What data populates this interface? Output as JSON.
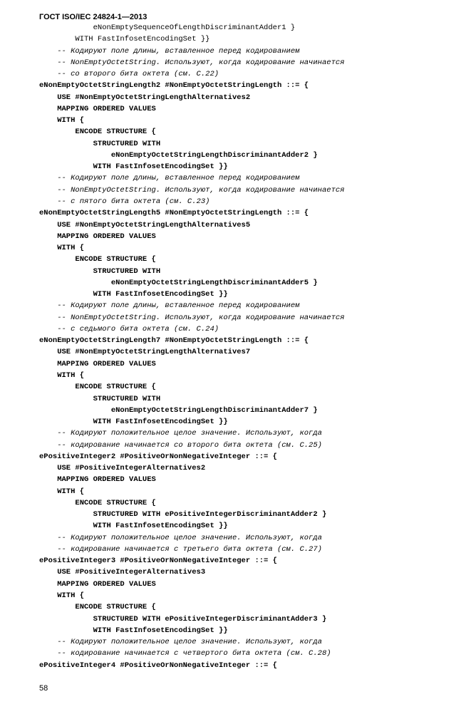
{
  "header": {
    "title": "ГОСТ ISO/IEC 24824-1—2013"
  },
  "page_number": "58",
  "code": [
    {
      "text": "            eNonEmptySequenceOfLengthDiscriminantAdder1 }",
      "bold": false,
      "italic": false
    },
    {
      "text": "        WITH FastInfosetEncodingSet }}",
      "bold": false,
      "italic": false
    },
    {
      "text": "    -- Кодируют поле длины, вставленное перед кодированием",
      "bold": false,
      "italic": true
    },
    {
      "text": "    -- NonEmptyOctetString. Используют, когда кодирование начинается",
      "bold": false,
      "italic": true
    },
    {
      "text": "    -- со второго бита октета (см. С.22)",
      "bold": false,
      "italic": true
    },
    {
      "text": "eNonEmptyOctetStringLength2 #NonEmptyOctetStringLength ::= {",
      "bold": true,
      "italic": false
    },
    {
      "text": "    USE #NonEmptyOctetStringLengthAlternatives2",
      "bold": true,
      "italic": false
    },
    {
      "text": "    MAPPING ORDERED VALUES",
      "bold": true,
      "italic": false
    },
    {
      "text": "    WITH {",
      "bold": true,
      "italic": false
    },
    {
      "text": "        ENCODE STRUCTURE {",
      "bold": true,
      "italic": false
    },
    {
      "text": "            STRUCTURED WITH",
      "bold": true,
      "italic": false
    },
    {
      "text": "                eNonEmptyOctetStringLengthDiscriminantAdder2 }",
      "bold": true,
      "italic": false
    },
    {
      "text": "            WITH FastInfosetEncodingSet }}",
      "bold": true,
      "italic": false
    },
    {
      "text": "    -- Кодируют поле длины, вставленное перед кодированием",
      "bold": false,
      "italic": true
    },
    {
      "text": "    -- NonEmptyOctetString. Используют, когда кодирование начинается",
      "bold": false,
      "italic": true
    },
    {
      "text": "    -- с пятого бита октета (см. С.23)",
      "bold": false,
      "italic": true
    },
    {
      "text": "eNonEmptyOctetStringLength5 #NonEmptyOctetStringLength ::= {",
      "bold": true,
      "italic": false
    },
    {
      "text": "    USE #NonEmptyOctetStringLengthAlternatives5",
      "bold": true,
      "italic": false
    },
    {
      "text": "    MAPPING ORDERED VALUES",
      "bold": true,
      "italic": false
    },
    {
      "text": "    WITH {",
      "bold": true,
      "italic": false
    },
    {
      "text": "        ENCODE STRUCTURE {",
      "bold": true,
      "italic": false
    },
    {
      "text": "            STRUCTURED WITH",
      "bold": true,
      "italic": false
    },
    {
      "text": "                eNonEmptyOctetStringLengthDiscriminantAdder5 }",
      "bold": true,
      "italic": false
    },
    {
      "text": "            WITH FastInfosetEncodingSet }}",
      "bold": true,
      "italic": false
    },
    {
      "text": "    -- Кодируют поле длины, вставленное перед кодированием",
      "bold": false,
      "italic": true
    },
    {
      "text": "    -- NonEmptyOctetString. Используют, когда кодирование начинается",
      "bold": false,
      "italic": true
    },
    {
      "text": "    -- с седьмого бита октета (см. С.24)",
      "bold": false,
      "italic": true
    },
    {
      "text": "eNonEmptyOctetStringLength7 #NonEmptyOctetStringLength ::= {",
      "bold": true,
      "italic": false
    },
    {
      "text": "    USE #NonEmptyOctetStringLengthAlternatives7",
      "bold": true,
      "italic": false
    },
    {
      "text": "    MAPPING ORDERED VALUES",
      "bold": true,
      "italic": false
    },
    {
      "text": "    WITH {",
      "bold": true,
      "italic": false
    },
    {
      "text": "        ENCODE STRUCTURE {",
      "bold": true,
      "italic": false
    },
    {
      "text": "            STRUCTURED WITH",
      "bold": true,
      "italic": false
    },
    {
      "text": "                eNonEmptyOctetStringLengthDiscriminantAdder7 }",
      "bold": true,
      "italic": false
    },
    {
      "text": "            WITH FastInfosetEncodingSet }}",
      "bold": true,
      "italic": false
    },
    {
      "text": "    -- Кодируют положительное целое значение. Используют, когда",
      "bold": false,
      "italic": true
    },
    {
      "text": "    -- кодирование начинается со второго бита октета (см. С.25)",
      "bold": false,
      "italic": true
    },
    {
      "text": "ePositiveInteger2 #PositiveOrNonNegativeInteger ::= {",
      "bold": true,
      "italic": false
    },
    {
      "text": "    USE #PositiveIntegerAlternatives2",
      "bold": true,
      "italic": false
    },
    {
      "text": "    MAPPING ORDERED VALUES",
      "bold": true,
      "italic": false
    },
    {
      "text": "    WITH {",
      "bold": true,
      "italic": false
    },
    {
      "text": "        ENCODE STRUCTURE {",
      "bold": true,
      "italic": false
    },
    {
      "text": "            STRUCTURED WITH ePositiveIntegerDiscriminantAdder2 }",
      "bold": true,
      "italic": false
    },
    {
      "text": "            WITH FastInfosetEncodingSet }}",
      "bold": true,
      "italic": false
    },
    {
      "text": "    -- Кодируют положительное целое значение. Используют, когда",
      "bold": false,
      "italic": true
    },
    {
      "text": "    -- кодирование начинается с третьего бита октета (см. С.27)",
      "bold": false,
      "italic": true
    },
    {
      "text": "ePositiveInteger3 #PositiveOrNonNegativeInteger ::= {",
      "bold": true,
      "italic": false
    },
    {
      "text": "    USE #PositiveIntegerAlternatives3",
      "bold": true,
      "italic": false
    },
    {
      "text": "    MAPPING ORDERED VALUES",
      "bold": true,
      "italic": false
    },
    {
      "text": "    WITH {",
      "bold": true,
      "italic": false
    },
    {
      "text": "        ENCODE STRUCTURE {",
      "bold": true,
      "italic": false
    },
    {
      "text": "            STRUCTURED WITH ePositiveIntegerDiscriminantAdder3 }",
      "bold": true,
      "italic": false
    },
    {
      "text": "            WITH FastInfosetEncodingSet }}",
      "bold": true,
      "italic": false
    },
    {
      "text": "    -- Кодируют положительное целое значение. Используют, когда",
      "bold": false,
      "italic": true
    },
    {
      "text": "    -- кодирование начинается с четвертого бита октета (см. С.28)",
      "bold": false,
      "italic": true
    },
    {
      "text": "ePositiveInteger4 #PositiveOrNonNegativeInteger ::= {",
      "bold": true,
      "italic": false
    }
  ]
}
